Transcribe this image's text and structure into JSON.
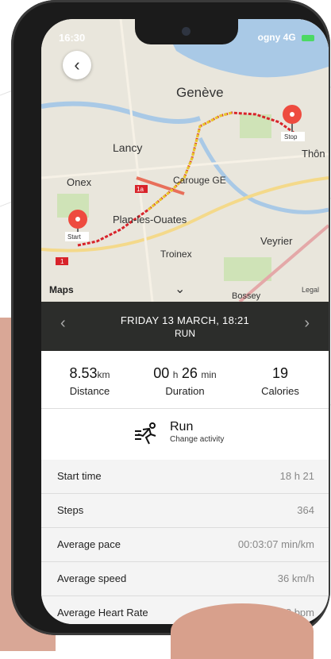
{
  "status": {
    "time": "16:30",
    "carrier": "ogny",
    "network": "4G"
  },
  "map": {
    "provider": "Maps",
    "legal": "Legal",
    "labels": [
      "Genève",
      "Lancy",
      "Onex",
      "Carouge GE",
      "Plan-les-Ouates",
      "Troinex",
      "Veyrier",
      "Thôn",
      "Bossey",
      "1a",
      "1"
    ],
    "start_label": "Start",
    "stop_label": "Stop"
  },
  "date_bar": {
    "date": "FRIDAY 13 MARCH, 18:21",
    "activity": "RUN"
  },
  "stats": {
    "distance": {
      "value": "8.53",
      "unit": "km",
      "label": "Distance"
    },
    "duration": {
      "hours": "00",
      "hours_unit": "h",
      "minutes": "26",
      "minutes_unit": "min",
      "label": "Duration"
    },
    "calories": {
      "value": "19",
      "label": "Calories"
    }
  },
  "activity": {
    "name": "Run",
    "change_label": "Change activity",
    "icon": "runner-icon"
  },
  "details": [
    {
      "key": "Start time",
      "value": "18 h 21"
    },
    {
      "key": "Steps",
      "value": "364"
    },
    {
      "key": "Average pace",
      "value": "00:03:07 min/km"
    },
    {
      "key": "Average speed",
      "value": "36 km/h"
    },
    {
      "key": "Average Heart Rate",
      "value": "88 bpm"
    }
  ],
  "colors": {
    "route_start": "#d8232a",
    "route_mid": "#e9c62a",
    "route_end": "#a3d739",
    "date_bar_bg": "#2c2d2b"
  }
}
